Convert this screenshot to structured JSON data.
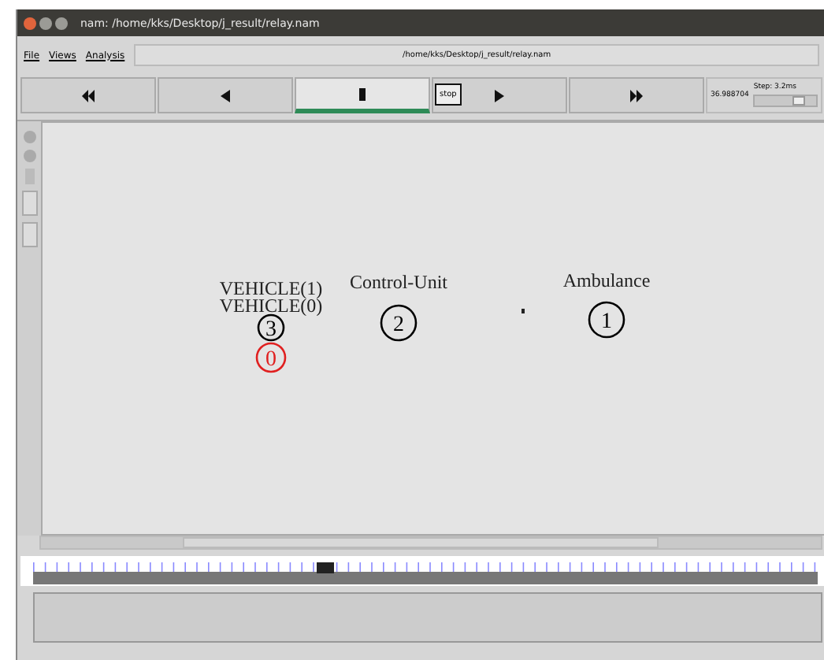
{
  "window": {
    "title": "nam: /home/kks/Desktop/j_result/relay.nam"
  },
  "menu": [
    {
      "label": "File"
    },
    {
      "label": "Views"
    },
    {
      "label": "Analysis"
    }
  ],
  "file_path": "/home/kks/Desktop/j_result/relay.nam",
  "transport": [
    {
      "kind": "rewind",
      "selected": false
    },
    {
      "kind": "back",
      "selected": false
    },
    {
      "kind": "stop",
      "selected": true
    },
    {
      "kind": "play",
      "selected": false
    },
    {
      "kind": "forward",
      "selected": false
    }
  ],
  "tooltip": "stop",
  "time": "36.988704",
  "step": {
    "label": "Step: 3.2ms",
    "level": 0.72
  },
  "nodes": [
    {
      "label": "VEHICLE(1)",
      "id": "3",
      "color": "#000000"
    },
    {
      "label": "VEHICLE(0)",
      "id": "0",
      "color": "#e02020"
    },
    {
      "label": "Control-Unit",
      "id": "2",
      "color": "#000000"
    },
    {
      "label": "Ambulance",
      "id": "1",
      "color": "#000000"
    }
  ]
}
